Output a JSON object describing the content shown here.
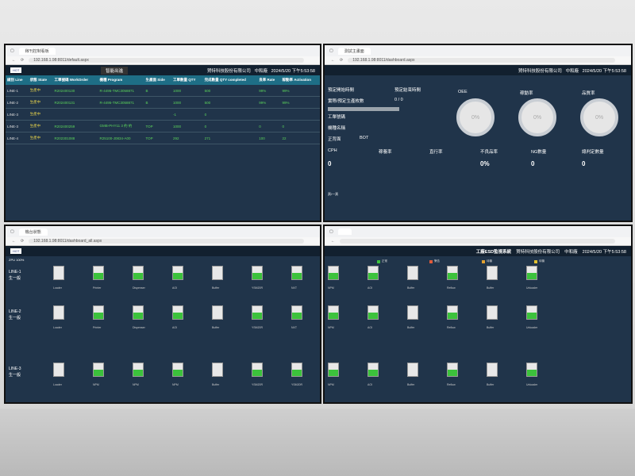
{
  "screen1": {
    "tab": "稼刊控制看板",
    "url": "192.168.1.98:8011/default.aspx",
    "header": {
      "company": "賀特科技股份有限公司",
      "site": "中和廠",
      "time": "2024/5/20 下午5:53:58",
      "button": "智能出進"
    },
    "columns": [
      "線別 Line",
      "狀態 State",
      "工單號碼 WorkOrder",
      "機種 Program",
      "生產面 Side",
      "工單數量 QTY",
      "完成數量 QTY completed",
      "良率 Rate",
      "稼動率 Activation"
    ],
    "rows": [
      [
        "LINE-1",
        "生產中",
        "R202400130",
        "R-4495-TMC3058871",
        "B",
        "1000",
        "500",
        "99%",
        "99%"
      ],
      [
        "LINE-2",
        "生產中",
        "R202400131",
        "R-4495-TMC3058871",
        "B",
        "1000",
        "500",
        "99%",
        "99%"
      ],
      [
        "LINE-3",
        "生產中",
        "",
        "",
        "",
        "-1",
        "0",
        "",
        ""
      ],
      [
        "LINE-3",
        "生產中",
        "R202400259",
        "GMB-PHY11 3 約 約",
        "TOP",
        "1000",
        "0",
        "0",
        "0"
      ],
      [
        "LINE-4",
        "生產中",
        "R202301088",
        "R25100-J0834-A00",
        "TOP",
        "292",
        "271",
        "100",
        "22"
      ]
    ]
  },
  "screen2": {
    "tab": "測試主畫面",
    "url": "192.168.1.98:8011/dashboard.aspx",
    "header": {
      "company": "賀特科技股份有限公司",
      "site": "中和廠",
      "time": "2024/5/20 下午5:53:58"
    },
    "labels": {
      "start": "預定開始時間",
      "end": "預定結束時間",
      "qty": "實際/預定生產枚數",
      "qty_val": "0 / 0",
      "wo": "工單號碼",
      "model": "機種名稱",
      "side": "正背面",
      "side_val": "BOT",
      "oee": "OEE",
      "avail": "稼動率",
      "quality": "品質率"
    },
    "gauges": [
      "0%",
      "0%",
      "0%"
    ],
    "metrics": [
      {
        "label": "CPH",
        "value": "0"
      },
      {
        "label": "稼養率",
        "value": ""
      },
      {
        "label": "直行率",
        "value": ""
      },
      {
        "label": "不良品率",
        "value": "0%"
      },
      {
        "label": "NG數量",
        "value": "0"
      },
      {
        "label": "總判定數量",
        "value": "0"
      }
    ],
    "footnote": "頁/一頁"
  },
  "screen3": {
    "tab": "機台狀態",
    "url": "192.168.1.98:8011/dashboard_all.aspx",
    "badge": "ZPU 100%",
    "lines": [
      {
        "name": "LINE-1",
        "sub": "生一般",
        "machines": [
          "Loader",
          "Printer",
          "Dispenser",
          "AOI",
          "Buffer",
          "YSM20R",
          "NXT"
        ]
      },
      {
        "name": "LINE-2",
        "sub": "生一般",
        "machines": [
          "Loader",
          "Printer",
          "Dispenser",
          "AOI",
          "Buffer",
          "YSM20R",
          "NXT"
        ]
      },
      {
        "name": "LINE-3",
        "sub": "生一般",
        "machines": [
          "Loader",
          "NPM",
          "NPM",
          "NPM",
          "Buffer",
          "YSM20R",
          "YSM20R"
        ]
      }
    ]
  },
  "screen4": {
    "title": "工廠ESD監視系統",
    "header": {
      "company": "賀特科技股份有限公司",
      "site": "中和廠",
      "time": "2024/5/20 下午5:53:58"
    },
    "legend": [
      {
        "label": "正常",
        "color": "#3cc23c"
      },
      {
        "label": "警告",
        "color": "#e05a3a"
      },
      {
        "label": "待機",
        "color": "#e0a030"
      },
      {
        "label": "待機",
        "color": "#e0c030"
      }
    ],
    "machines": [
      "NPM",
      "AOI",
      "Buffer",
      "Reflow",
      "Buffer",
      "Unloader"
    ]
  }
}
